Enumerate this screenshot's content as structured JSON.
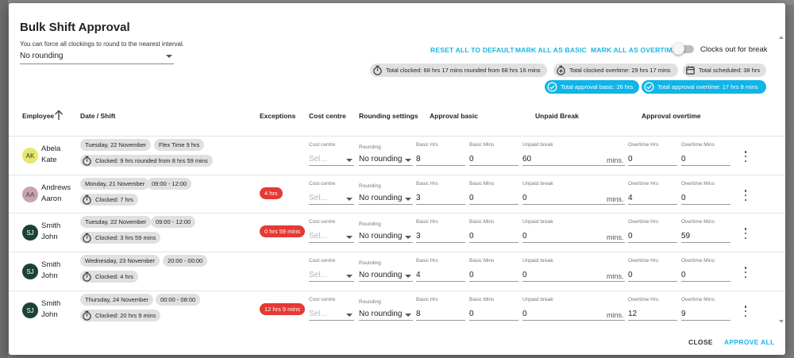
{
  "dialog": {
    "title": "Bulk Shift Approval",
    "rounding_hint": "You can force all clockings to round to the nearest interval.",
    "rounding_value": "No rounding",
    "actions": {
      "reset": "RESET ALL TO DEFAULT",
      "mark_basic": "MARK ALL AS BASIC",
      "mark_overtime": "MARK ALL AS OVERTIME"
    },
    "toggle_label": "Clocks out for break",
    "toggle_on": false,
    "summary": {
      "total_clocked": "Total clocked: 68 hrs 17 mins rounded from 68 hrs 16 mins",
      "total_clocked_overtime": "Total clocked overtime: 29 hrs 17 mins",
      "total_scheduled": "Total scheduled: 38 hrs",
      "total_approval_basic": "Total approval basic: 26 hrs",
      "total_approval_overtime": "Total approval overtime: 17 hrs 8 mins"
    },
    "columns": {
      "employee": "Employee",
      "date_shift": "Date / Shift",
      "exceptions": "Exceptions",
      "cost_centre": "Cost centre",
      "rounding": "Rounding settings",
      "approval_basic": "Approval basic",
      "unpaid_break": "Unpaid Break",
      "approval_overtime": "Approval overtime"
    },
    "field_labels": {
      "cost_centre": "Cost centre",
      "rounding": "Rounding",
      "basic_hrs": "Basic Hrs",
      "basic_mins": "Basic Mins",
      "unpaid_break": "Unpaid break",
      "overtime_hrs": "Overtime Hrs",
      "overtime_mins": "Overtime Mins",
      "mins_suffix": "mins.",
      "select_placeholder": "Sel..."
    },
    "rows": [
      {
        "initials": "AK",
        "first": "Abela",
        "last": "Kate",
        "avatar_bg": "#e5e86a",
        "avatar_fg": "#333333",
        "date": "Tuesday, 22 November",
        "shift": "Flex Time 9 hrs",
        "clocked": "Clocked: 9 hrs rounded from 8 hrs 59 mins",
        "exception": "",
        "rounding": "No rounding",
        "basic_hrs": "8",
        "basic_mins": "0",
        "unpaid_break": "60",
        "overtime_hrs": "0",
        "overtime_mins": "0"
      },
      {
        "initials": "AA",
        "first": "Andrews",
        "last": "Aaron",
        "avatar_bg": "#c9a3ad",
        "avatar_fg": "#444444",
        "date": "Monday, 21 November",
        "shift": "09:00 - 12:00",
        "clocked": "Clocked: 7 hrs",
        "exception": "4 hrs",
        "rounding": "No rounding",
        "basic_hrs": "3",
        "basic_mins": "0",
        "unpaid_break": "0",
        "overtime_hrs": "4",
        "overtime_mins": "0"
      },
      {
        "initials": "SJ",
        "first": "Smith",
        "last": "John",
        "avatar_bg": "#1b4332",
        "avatar_fg": "#ffffff",
        "date": "Tuesday, 22 November",
        "shift": "09:00 - 12:00",
        "clocked": "Clocked: 3 hrs 59 mins",
        "exception": "0 hrs 59 mins",
        "rounding": "No rounding",
        "basic_hrs": "3",
        "basic_mins": "0",
        "unpaid_break": "0",
        "overtime_hrs": "0",
        "overtime_mins": "59"
      },
      {
        "initials": "SJ",
        "first": "Smith",
        "last": "John",
        "avatar_bg": "#1b4332",
        "avatar_fg": "#ffffff",
        "date": "Wednesday, 23 November",
        "shift": "20:00 - 00:00",
        "clocked": "Clocked: 4 hrs",
        "exception": "",
        "rounding": "No rounding",
        "basic_hrs": "4",
        "basic_mins": "0",
        "unpaid_break": "0",
        "overtime_hrs": "0",
        "overtime_mins": "0"
      },
      {
        "initials": "SJ",
        "first": "Smith",
        "last": "John",
        "avatar_bg": "#1b4332",
        "avatar_fg": "#ffffff",
        "date": "Thursday, 24 November",
        "shift": "00:00 - 08:00",
        "clocked": "Clocked: 20 hrs 9 mins",
        "exception": "12 hrs 9 mins",
        "rounding": "No rounding",
        "basic_hrs": "8",
        "basic_mins": "0",
        "unpaid_break": "0",
        "overtime_hrs": "12",
        "overtime_mins": "9"
      }
    ],
    "footer": {
      "close": "CLOSE",
      "approve_all": "APPROVE ALL"
    },
    "colors": {
      "accent": "#1cb5e0",
      "chip_blue": "#10b5e8",
      "exception": "#e53935",
      "chip_grey": "#e0e0e0"
    }
  }
}
